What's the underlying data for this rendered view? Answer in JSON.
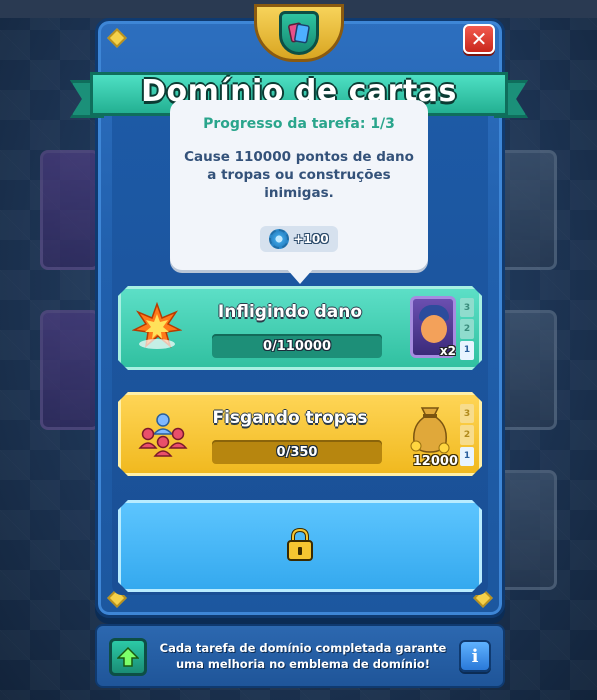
{
  "dialog": {
    "title": "Domínio de cartas",
    "close_label": "✕"
  },
  "tooltip": {
    "header": "Progresso da tarefa: 1/3",
    "description": "Cause 110000 pontos de dano a tropas ou construções inimigas.",
    "reward_value": "+100",
    "reward_icon": "gear-icon"
  },
  "tasks": [
    {
      "name": "Infligindo dano",
      "progress_text": "0/110000",
      "progress": 0,
      "icon": "explosion-icon",
      "reward_icon": "card-icon",
      "reward_badge": "x2",
      "tiers": [
        "3",
        "2",
        "1"
      ],
      "active_tier": "1",
      "color": "#3fcfb3"
    },
    {
      "name": "Fisgando tropas",
      "progress_text": "0/350",
      "progress": 0,
      "icon": "troops-icon",
      "reward_icon": "gold-bag-icon",
      "reward_badge": "12000",
      "tiers": [
        "3",
        "2",
        "1"
      ],
      "active_tier": "1",
      "color": "#f5c531"
    },
    {
      "locked": true,
      "icon": "lock-icon",
      "color": "#45b5f5"
    }
  ],
  "footer": {
    "text": "Cada tarefa de domínio completada garante uma melhoria no emblema de domínio!",
    "info_label": "i",
    "left_icon": "arrow-up-icon"
  },
  "colors": {
    "panel": "#2160ad",
    "ribbon": "#2fbf9f",
    "tooltip_header": "#2aa58c",
    "tooltip_text": "#34527a",
    "close": "#e0372b"
  }
}
